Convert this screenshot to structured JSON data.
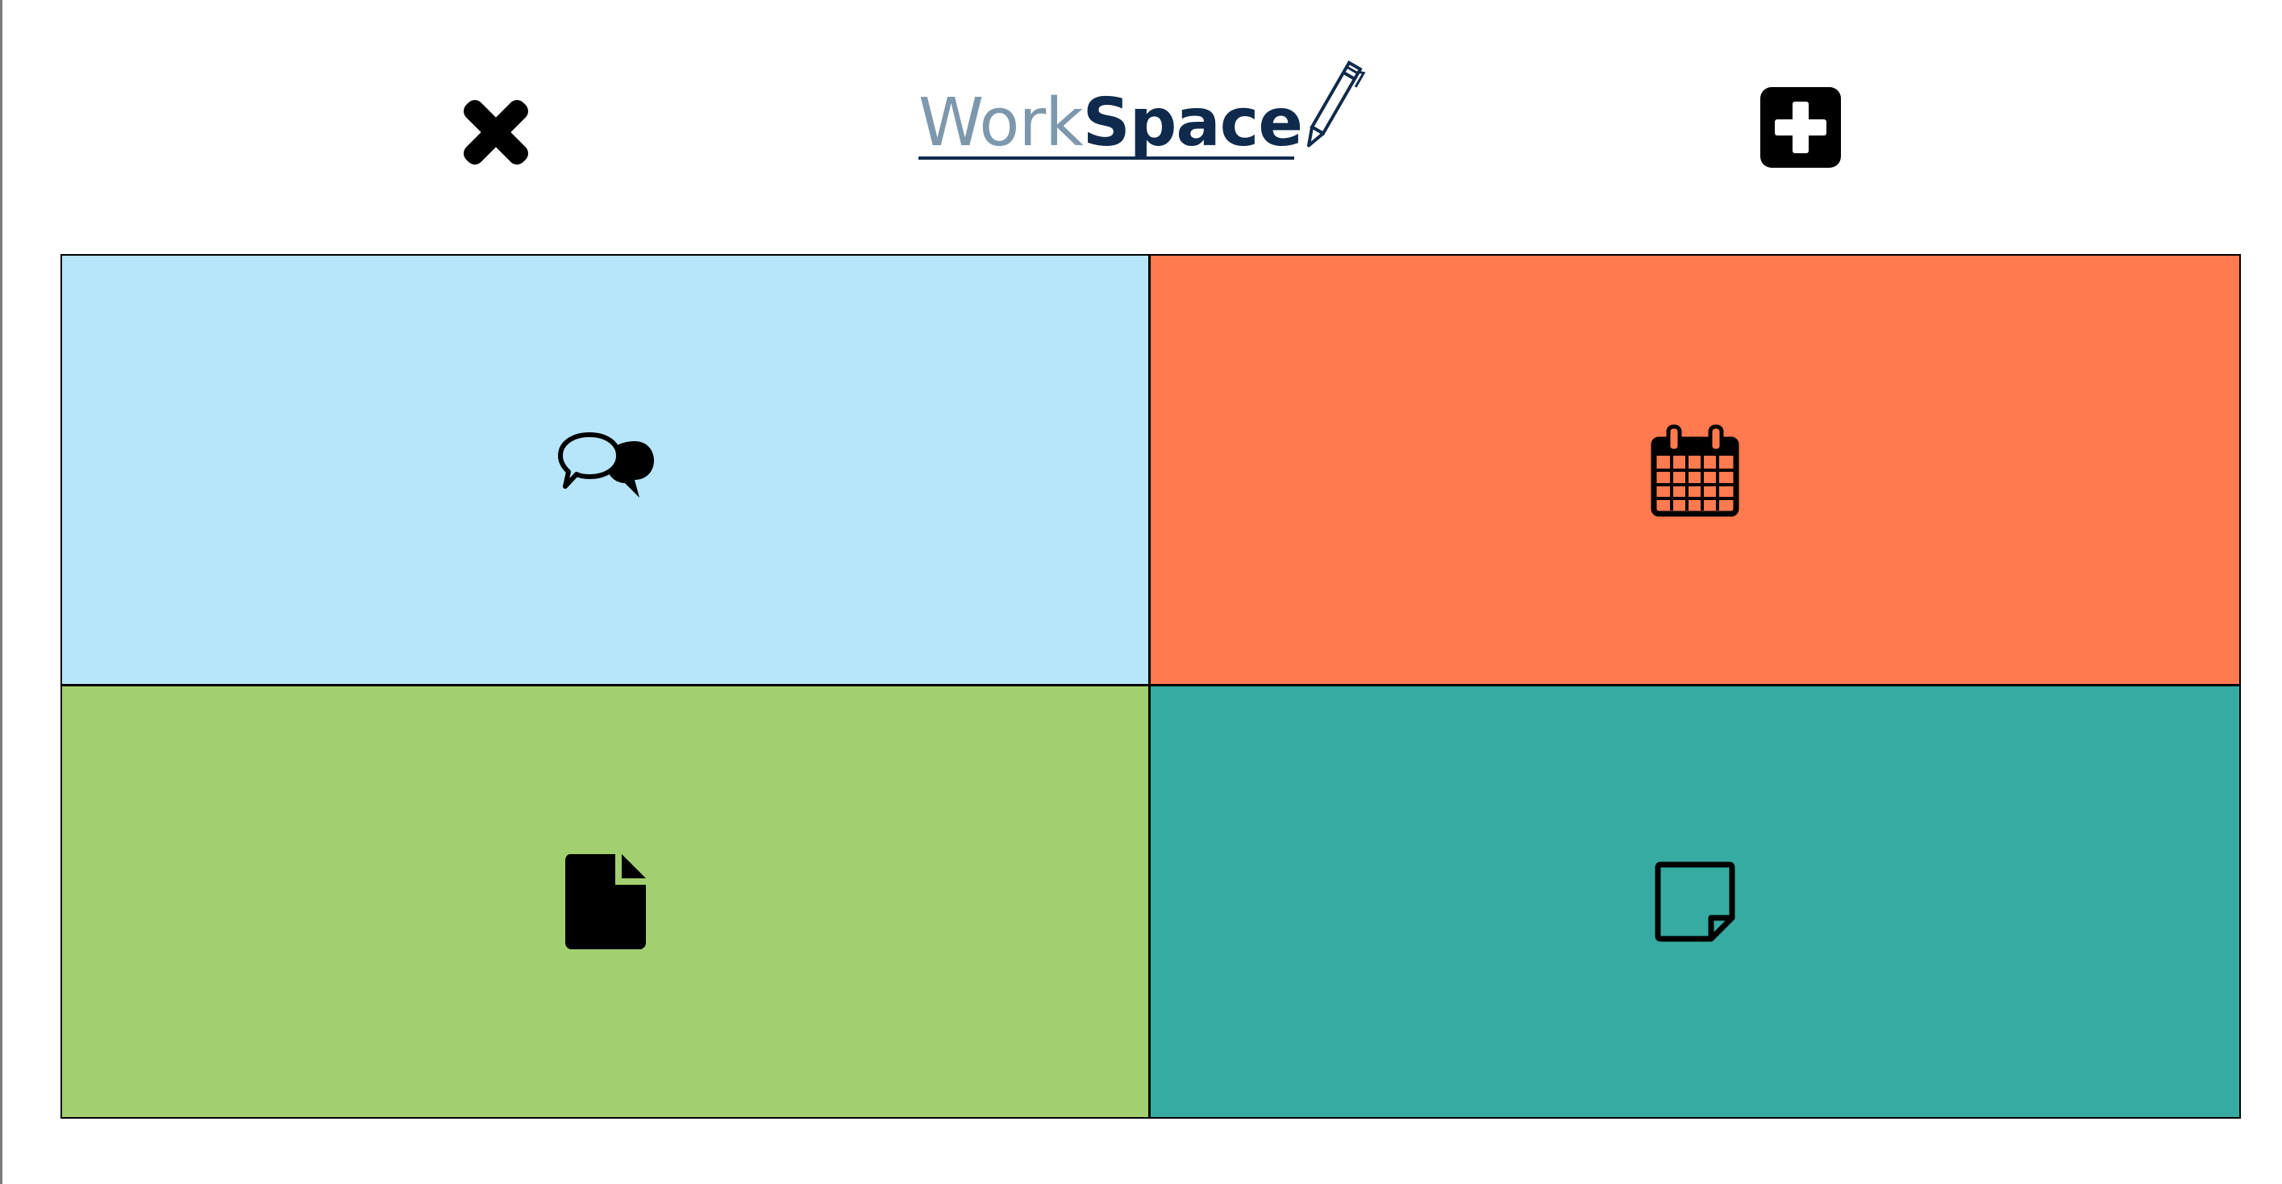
{
  "header": {
    "logo": {
      "part1": "Work",
      "part2": "Space",
      "icon": "pencil-icon",
      "part1_color": "#7d98ad",
      "part2_color": "#0f2a4c"
    },
    "close_icon": "close-icon",
    "add_icon": "plus-square-icon"
  },
  "tiles": [
    {
      "name": "chat",
      "icon": "chat-bubbles-icon",
      "color": "#b7e5fa"
    },
    {
      "name": "calendar",
      "icon": "calendar-icon",
      "color": "#ff7a4f"
    },
    {
      "name": "document",
      "icon": "document-icon",
      "color": "#a2cf6f"
    },
    {
      "name": "note",
      "icon": "sticky-note-icon",
      "color": "#36aba1"
    }
  ]
}
